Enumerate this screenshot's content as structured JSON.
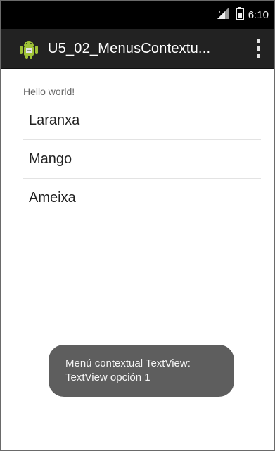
{
  "status_bar": {
    "time": "6:10",
    "icons": [
      "signal-icon",
      "battery-icon"
    ]
  },
  "action_bar": {
    "title": "U5_02_MenusContextu...",
    "app_icon": "android-robot-icon",
    "overflow_icon": "overflow-menu-icon"
  },
  "content": {
    "hello_text": "Hello world!",
    "list_items": [
      "Laranxa",
      "Mango",
      "Ameixa"
    ]
  },
  "toast": {
    "line1": "Menú contextual TextView:",
    "line2": "TextView opción 1"
  },
  "colors": {
    "status_bar": "#000000",
    "action_bar": "#222222",
    "toast_bg": "#5e5e5e",
    "android_green": "#9fc236"
  }
}
